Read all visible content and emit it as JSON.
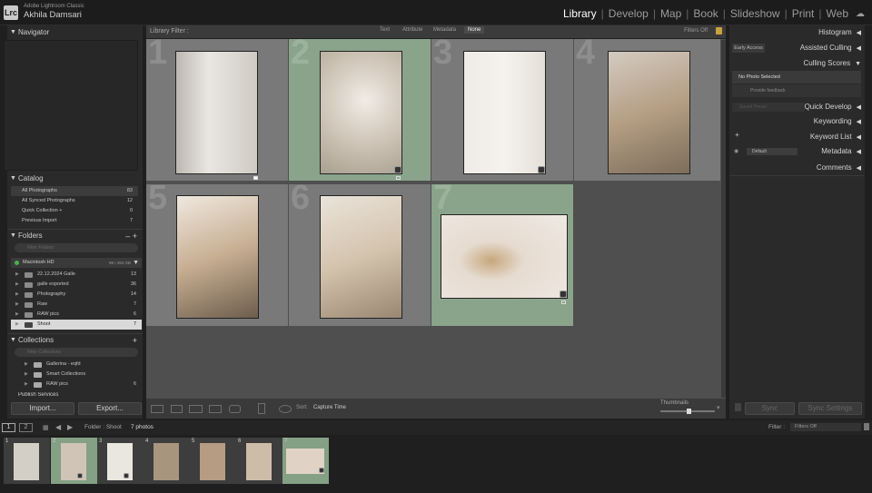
{
  "app": {
    "title": "Adobe Lightroom Classic",
    "user": "Akhila Damsari",
    "logo": "Lrc"
  },
  "modules": [
    "Library",
    "Develop",
    "Map",
    "Book",
    "Slideshow",
    "Print",
    "Web"
  ],
  "left": {
    "navigator": "Navigator",
    "catalog": {
      "title": "Catalog",
      "items": [
        {
          "label": "All Photographs",
          "count": "83"
        },
        {
          "label": "All Synced Photographs",
          "count": "12"
        },
        {
          "label": "Quick Collection +",
          "count": "0"
        },
        {
          "label": "Previous Import",
          "count": "7"
        }
      ]
    },
    "folders": {
      "title": "Folders",
      "search_placeholder": "Filter Folders",
      "volume": "Macintosh HD",
      "volume_size": "98 / 494 GB",
      "items": [
        {
          "name": "22.12.2024 Galle",
          "count": "13"
        },
        {
          "name": "galle exported",
          "count": "36"
        },
        {
          "name": "Photography",
          "count": "14"
        },
        {
          "name": "Raw",
          "count": "7"
        },
        {
          "name": "RAW pics",
          "count": "6"
        },
        {
          "name": "Shoot",
          "count": "7"
        }
      ]
    },
    "collections": {
      "title": "Collections",
      "search_placeholder": "Filter Collections",
      "items": [
        {
          "name": "Gallerina - eqfd"
        },
        {
          "name": "Smart Collections"
        },
        {
          "name": "RAW pics",
          "count": "6"
        }
      ]
    },
    "publish": "Publish Services",
    "import_btn": "Import...",
    "export_btn": "Export..."
  },
  "filterbar": {
    "label": "Library Filter :",
    "tabs": [
      "Text",
      "Attribute",
      "Metadata",
      "None"
    ],
    "active": "None",
    "status": "Filters Off"
  },
  "grid": {
    "cells": [
      {
        "num": "1",
        "green": false,
        "color": "#d8d3cc"
      },
      {
        "num": "2",
        "green": true,
        "color": "#d9d2c6"
      },
      {
        "num": "3",
        "green": false,
        "color": "#e6e1da"
      },
      {
        "num": "4",
        "green": false,
        "color": "#b4a896"
      },
      {
        "num": "5",
        "green": false,
        "color": "#c9b6a0"
      },
      {
        "num": "6",
        "green": false,
        "color": "#d6c9b6"
      },
      {
        "num": "7",
        "green": true,
        "color": "#e3d9cf"
      }
    ]
  },
  "toolbar": {
    "sort_label": "Sort:",
    "sort_value": "Capture Time",
    "thumbnails_label": "Thumbnails"
  },
  "right": {
    "histogram": "Histogram",
    "early_access": "Early Access",
    "assisted_culling": "Assisted Culling",
    "culling_scores": "Culling Scores",
    "no_photo": "No Photo Selected",
    "provide_feedback": "Provide feedback",
    "saved_preset": "Saved Preset",
    "quick_develop": "Quick Develop",
    "keywording": "Keywording",
    "keyword_list": "Keyword List",
    "metadata_preset": "Default",
    "metadata": "Metadata",
    "comments": "Comments",
    "sync": "Sync",
    "sync_settings": "Sync Settings"
  },
  "filmstrip": {
    "path": "Folder : Shoot",
    "count": "7 photos",
    "filter_label": "Filter :",
    "filter_value": "Filters Off",
    "pages": [
      "1",
      "2"
    ]
  }
}
